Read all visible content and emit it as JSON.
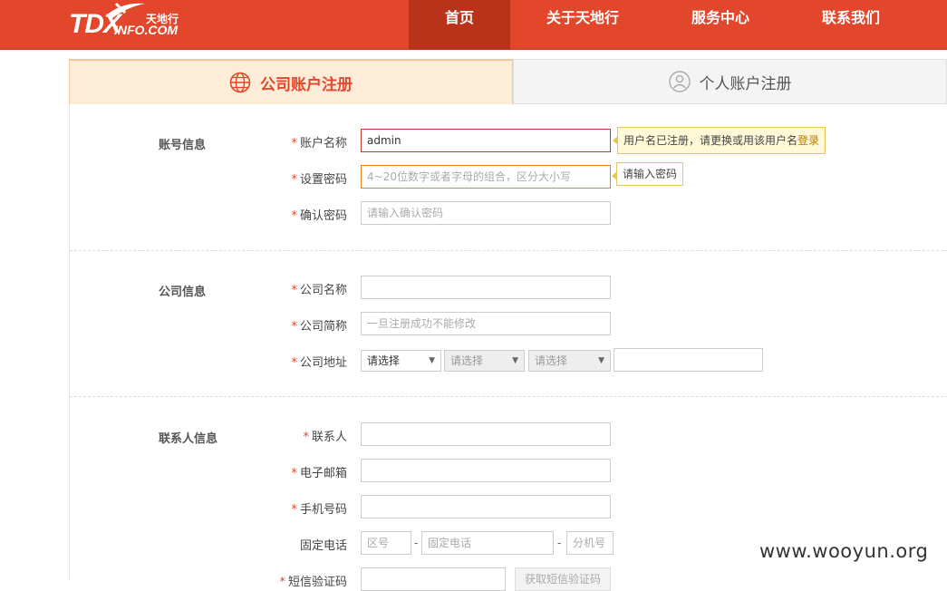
{
  "logo": {
    "main": "TDX",
    "sub": "INFO.COM",
    "cn": "天地行"
  },
  "nav": [
    {
      "label": "首页",
      "active": true
    },
    {
      "label": "关于天地行",
      "active": false
    },
    {
      "label": "服务中心",
      "active": false
    },
    {
      "label": "联系我们",
      "active": false
    }
  ],
  "tabs": {
    "company": "公司账户注册",
    "personal": "个人账户注册"
  },
  "sections": {
    "account": "账号信息",
    "company": "公司信息",
    "contact": "联系人信息"
  },
  "fields": {
    "account_name": {
      "label": "账户名称",
      "value": "admin"
    },
    "password": {
      "label": "设置密码",
      "placeholder": "4~20位数字或者字母的组合，区分大小写"
    },
    "confirm_password": {
      "label": "确认密码",
      "placeholder": "请输入确认密码"
    },
    "company_name": {
      "label": "公司名称",
      "value": ""
    },
    "company_short": {
      "label": "公司简称",
      "placeholder": "一旦注册成功不能修改"
    },
    "company_address": {
      "label": "公司地址",
      "select1": "请选择",
      "select2": "请选择",
      "select3": "请选择"
    },
    "contact_person": {
      "label": "联系人"
    },
    "email": {
      "label": "电子邮箱"
    },
    "mobile": {
      "label": "手机号码"
    },
    "phone": {
      "label": "固定电话",
      "area_placeholder": "区号",
      "number_placeholder": "固定电话",
      "ext_placeholder": "分机号"
    },
    "sms_code": {
      "label": "短信验证码",
      "button": "获取短信验证码"
    }
  },
  "tips": {
    "account_error": "用户名已注册，请更换或用该用户名",
    "account_error_link": "登录",
    "password_hint": "请输入密码"
  },
  "required_mark": "*",
  "dash": "-",
  "watermark": "www.wooyun.org",
  "colors": {
    "brand": "#e2472c",
    "nav_active": "#b83319",
    "tab_active_bg": "#fdecd8"
  }
}
